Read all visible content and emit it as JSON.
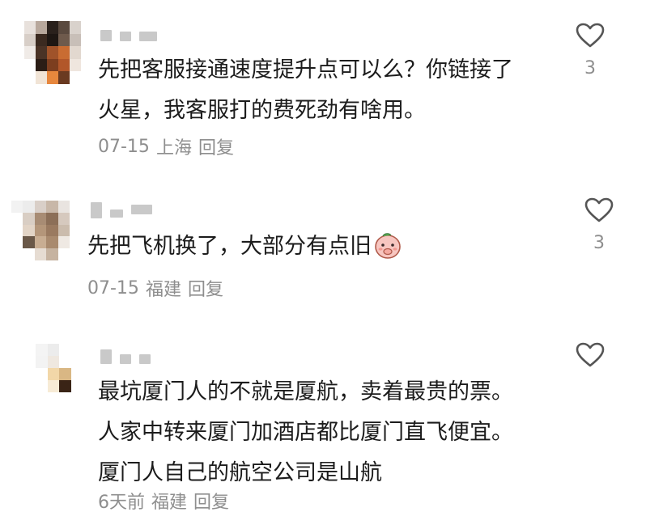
{
  "comments": [
    {
      "text_lines": [
        "先把客服接通速度提升点可以么？你链接了",
        "火星，我客服打的费死劲有啥用。"
      ],
      "date": "07-15",
      "location": "上海",
      "reply_label": "回复",
      "likes": "3",
      "like_icon": "heart-outline-icon"
    },
    {
      "text_lines": [
        "先把飞机换了，大部分有点旧"
      ],
      "emoji": "peach-covering-mouth-emoji",
      "date": "07-15",
      "location": "福建",
      "reply_label": "回复",
      "likes": "3",
      "like_icon": "heart-outline-icon"
    },
    {
      "text_lines": [
        "最坑厦门人的不就是厦航，卖着最贵的票。",
        "人家中转来厦门加酒店都比厦门直飞便宜。",
        "厦门人自己的航空公司是山航"
      ],
      "date": "6天前",
      "location": "福建",
      "reply_label": "回复",
      "likes": "",
      "like_icon": "heart-outline-icon"
    }
  ],
  "colors": {
    "text": "#1c1c1c",
    "meta": "#8e8e8e",
    "redacted_name": "#c9c9c9",
    "heart_stroke": "#555555"
  }
}
